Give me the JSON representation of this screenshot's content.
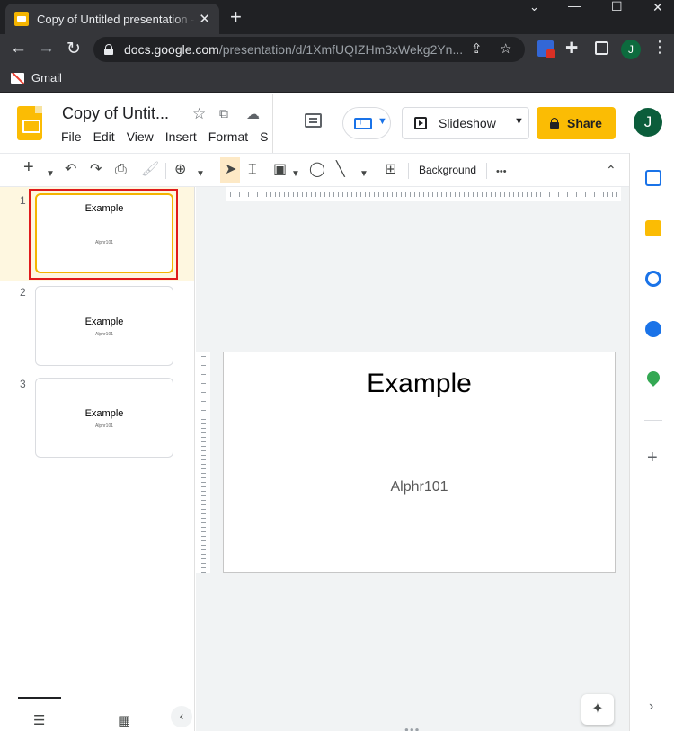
{
  "browser": {
    "tab_title": "Copy of Untitled presentation - Google Slides",
    "tab_close": "✕",
    "new_tab": "+",
    "window_controls": [
      "⌄",
      "—",
      "☐",
      "✕"
    ],
    "url_host": "docs.google.com",
    "url_path": "/presentation/d/1XmfUQIZHm3xWekg2Yn...",
    "profile_initial": "J",
    "bookmark_label": "Gmail"
  },
  "app": {
    "doc_title": "Copy of Untit...",
    "menu": [
      "File",
      "Edit",
      "View",
      "Insert",
      "Format",
      "S"
    ],
    "slideshow_label": "Slideshow",
    "share_label": "Share",
    "avatar_initial": "J"
  },
  "toolbar": {
    "background_label": "Background",
    "more_label": "•••"
  },
  "filmstrip": {
    "slides": [
      {
        "number": "1",
        "title": "Example",
        "subtitle": "Alphr101"
      },
      {
        "number": "2",
        "title": "Example",
        "subtitle": "Alphr101"
      },
      {
        "number": "3",
        "title": "Example",
        "subtitle": "Alphr101"
      }
    ],
    "selected_slide": 1
  },
  "slide": {
    "title": "Example",
    "subtitle": "Alphr101"
  },
  "colors": {
    "accent_yellow": "#fbbc04",
    "highlight_red": "#e01b1b",
    "chrome_dark": "#202124"
  },
  "icons": {
    "side_panel": [
      "calendar-icon",
      "keep-icon",
      "tasks-icon",
      "contacts-icon",
      "maps-icon",
      "plus-icon"
    ]
  }
}
